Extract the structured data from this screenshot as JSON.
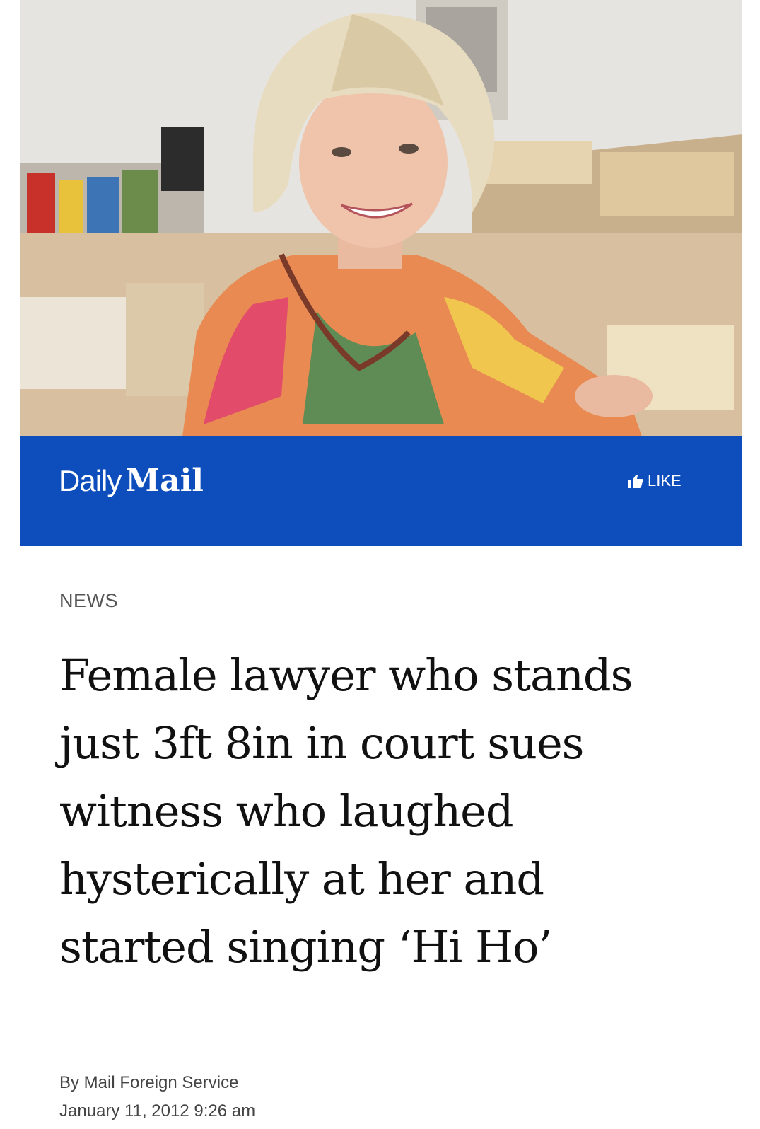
{
  "brand": {
    "logo_part1": "Daily",
    "logo_part2": "Mail",
    "like_label": "LIKE",
    "bar_color": "#0d4ebc"
  },
  "article": {
    "section": "NEWS",
    "headline": "Female lawyer who stands just 3ft 8in in court sues witness who laughed hysterically at her and started singing ‘Hi Ho’",
    "byline": "By Mail Foreign Service",
    "date": "January 11, 2012 9:26 am"
  },
  "icons": {
    "like": "thumbs-up-icon"
  }
}
